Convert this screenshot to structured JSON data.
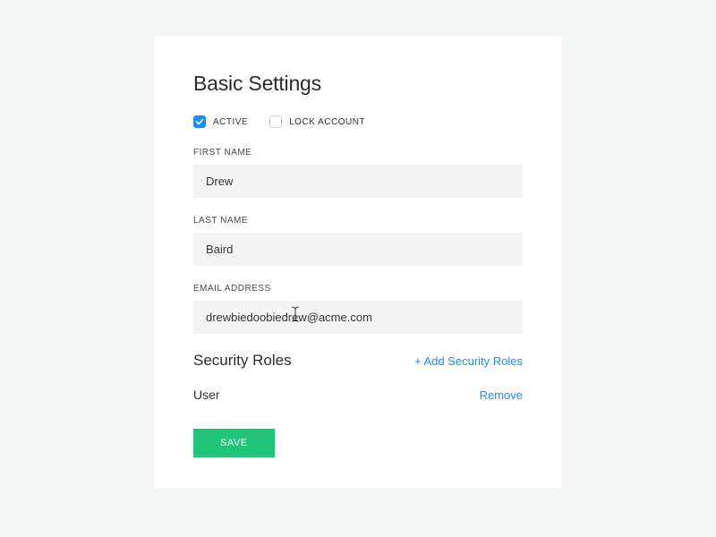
{
  "title": "Basic Settings",
  "checks": {
    "active_label": "ACTIVE",
    "active_checked": true,
    "lock_label": "LOCK ACCOUNT",
    "lock_checked": false
  },
  "fields": {
    "first_name_label": "FIRST NAME",
    "first_name_value": "Drew",
    "last_name_label": "LAST NAME",
    "last_name_value": "Baird",
    "email_label": "EMAIL ADDRESS",
    "email_value": "drewbiedoobiedrew@acme.com"
  },
  "roles_section": {
    "title": "Security Roles",
    "add_label": "+ Add Security Roles",
    "items": [
      {
        "name": "User",
        "remove_label": "Remove"
      }
    ]
  },
  "save_label": "SAVE"
}
